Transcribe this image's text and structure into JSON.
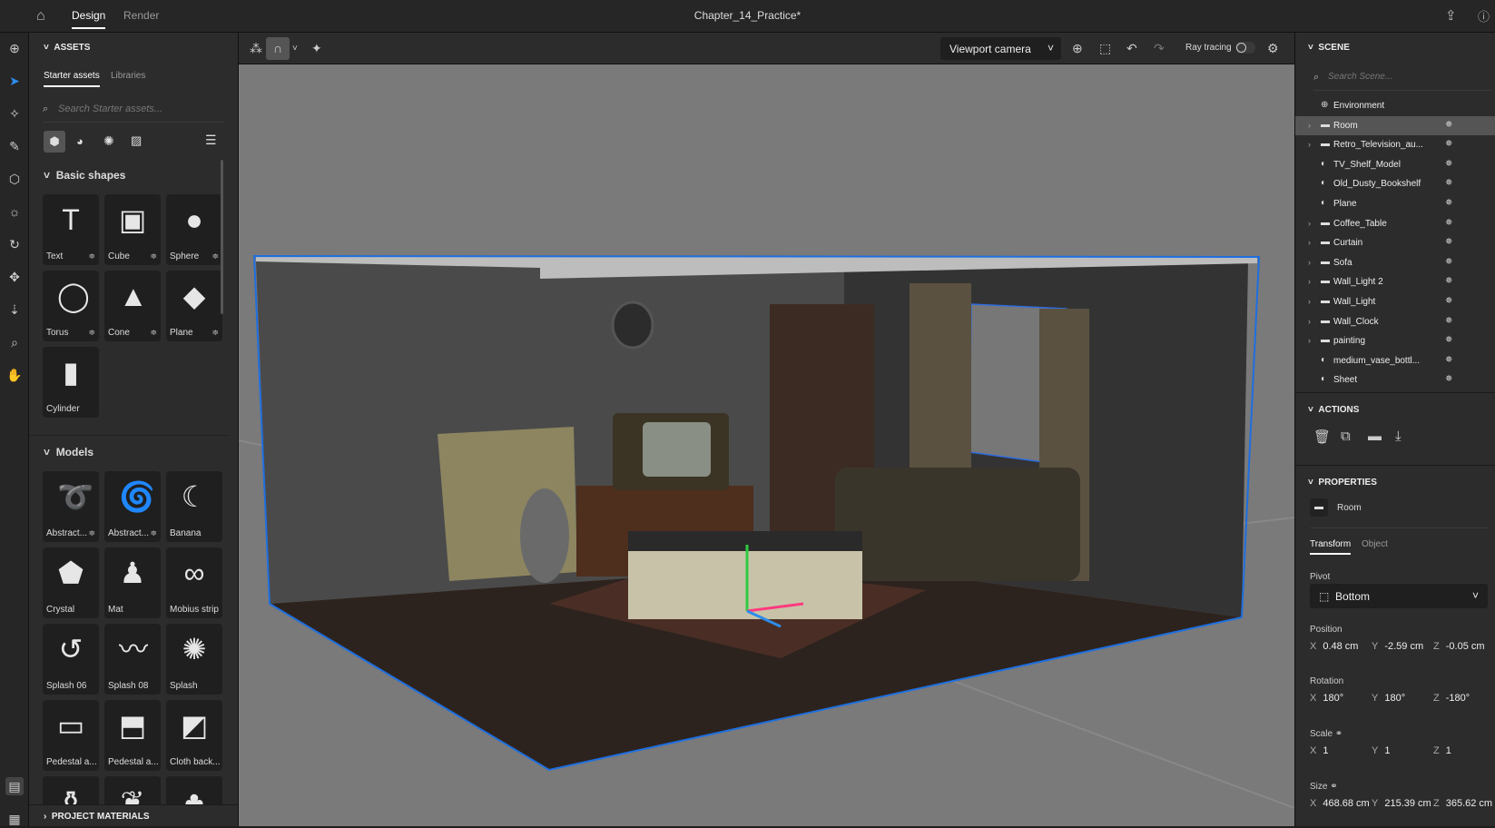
{
  "app": {
    "title": "Chapter_14_Practice*",
    "tabs": [
      "Design",
      "Render"
    ],
    "active_tab": "Design"
  },
  "assets": {
    "header": "ASSETS",
    "tabs": [
      "Starter assets",
      "Libraries"
    ],
    "search_placeholder": "Search Starter assets...",
    "filter_icons": [
      "cube-icon",
      "material-sphere-icon",
      "light-icon",
      "image-icon"
    ],
    "basic_shapes": {
      "title": "Basic shapes",
      "items": [
        {
          "label": "Text",
          "icon": "T"
        },
        {
          "label": "Cube",
          "icon": "▣"
        },
        {
          "label": "Sphere",
          "icon": "●"
        },
        {
          "label": "Torus",
          "icon": "◯"
        },
        {
          "label": "Cone",
          "icon": "▲"
        },
        {
          "label": "Plane",
          "icon": "◆"
        },
        {
          "label": "Cylinder",
          "icon": "▮"
        }
      ]
    },
    "models": {
      "title": "Models",
      "items": [
        {
          "label": "Abstract...",
          "icon": "➰",
          "opt": true
        },
        {
          "label": "Abstract...",
          "icon": "🌀",
          "opt": true
        },
        {
          "label": "Banana",
          "icon": "☾"
        },
        {
          "label": "Crystal",
          "icon": "⬟"
        },
        {
          "label": "Mat",
          "icon": "♟"
        },
        {
          "label": "Mobius strip",
          "icon": "∞"
        },
        {
          "label": "Splash 06",
          "icon": "↺"
        },
        {
          "label": "Splash 08",
          "icon": "〰"
        },
        {
          "label": "Splash",
          "icon": "✺"
        },
        {
          "label": "Pedestal a...",
          "icon": "▭"
        },
        {
          "label": "Pedestal a...",
          "icon": "⬒"
        },
        {
          "label": "Cloth back...",
          "icon": "◩"
        },
        {
          "label": "",
          "icon": "⚱"
        },
        {
          "label": "",
          "icon": "❦"
        },
        {
          "label": "",
          "icon": "♣"
        }
      ]
    },
    "project_materials": "PROJECT MATERIALS"
  },
  "viewport": {
    "camera": "Viewport camera",
    "ray_tracing_label": "Ray tracing",
    "ray_tracing_on": false
  },
  "scene": {
    "header": "SCENE",
    "search_placeholder": "Search Scene...",
    "items": [
      {
        "name": "Environment",
        "type": "environment",
        "expandable": false
      },
      {
        "name": "Room",
        "type": "group",
        "expandable": true,
        "selected": true
      },
      {
        "name": "Retro_Television_au...",
        "type": "group",
        "expandable": true
      },
      {
        "name": "TV_Shelf_Model",
        "type": "model",
        "expandable": false
      },
      {
        "name": "Old_Dusty_Bookshelf",
        "type": "model",
        "expandable": false
      },
      {
        "name": "Plane",
        "type": "model",
        "expandable": false
      },
      {
        "name": "Coffee_Table",
        "type": "group",
        "expandable": true
      },
      {
        "name": "Curtain",
        "type": "group",
        "expandable": true
      },
      {
        "name": "Sofa",
        "type": "group",
        "expandable": true
      },
      {
        "name": "Wall_Light 2",
        "type": "group",
        "expandable": true
      },
      {
        "name": "Wall_Light",
        "type": "group",
        "expandable": true
      },
      {
        "name": "Wall_Clock",
        "type": "group",
        "expandable": true
      },
      {
        "name": "painting",
        "type": "group",
        "expandable": true
      },
      {
        "name": "medium_vase_bottl...",
        "type": "model",
        "expandable": false
      },
      {
        "name": "Sheet",
        "type": "model",
        "expandable": false
      }
    ]
  },
  "actions": {
    "header": "ACTIONS",
    "icons": [
      "delete-icon",
      "duplicate-icon",
      "group-folder-icon",
      "drop-to-ground-icon"
    ]
  },
  "properties": {
    "header": "PROPERTIES",
    "object_name": "Room",
    "tabs": [
      "Transform",
      "Object"
    ],
    "pivot_label": "Pivot",
    "pivot": "Bottom",
    "position_label": "Position",
    "position": {
      "x": "0.48 cm",
      "y": "-2.59 cm",
      "z": "-0.05 cm"
    },
    "rotation_label": "Rotation",
    "rotation": {
      "x": "180°",
      "y": "180°",
      "z": "-180°"
    },
    "scale_label": "Scale",
    "scale": {
      "x": "1",
      "y": "1",
      "z": "1"
    },
    "size_label": "Size",
    "size": {
      "x": "468.68 cm",
      "y": "215.39 cm",
      "z": "365.62 cm"
    }
  },
  "colors": {
    "accent": "#2d8ceb",
    "selection_outline": "#1e6fe0",
    "panel": "#2c2c2c",
    "viewport_bg": "#7a7a7a"
  }
}
